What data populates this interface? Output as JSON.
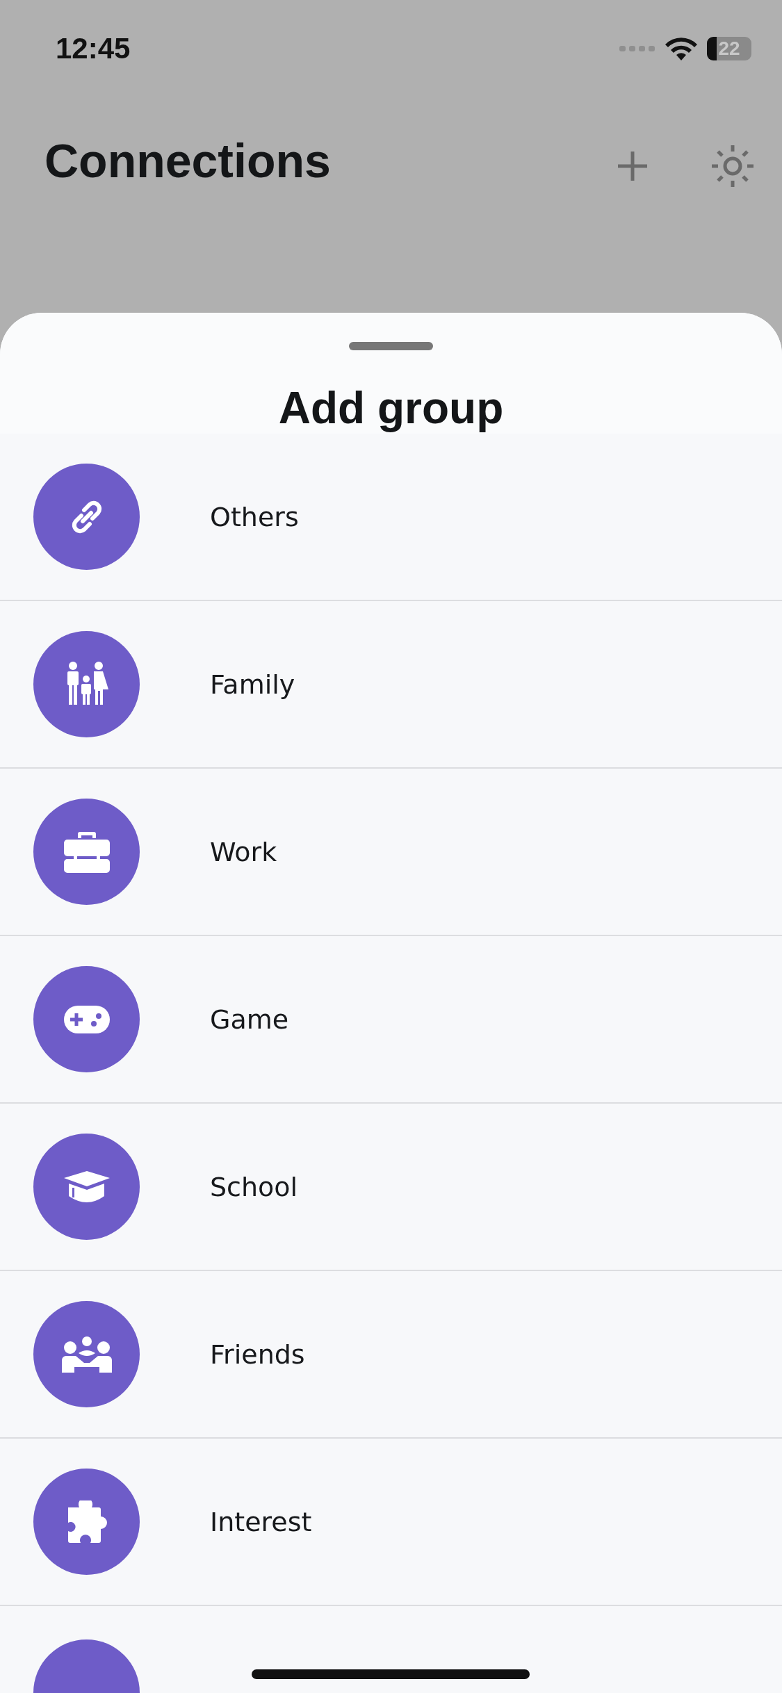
{
  "status_bar": {
    "time": "12:45",
    "battery": "22"
  },
  "header": {
    "title": "Connections"
  },
  "sheet": {
    "title": "Add group",
    "groups": [
      {
        "label": "Others"
      },
      {
        "label": "Family"
      },
      {
        "label": "Work"
      },
      {
        "label": "Game"
      },
      {
        "label": "School"
      },
      {
        "label": "Friends"
      },
      {
        "label": "Interest"
      }
    ]
  }
}
